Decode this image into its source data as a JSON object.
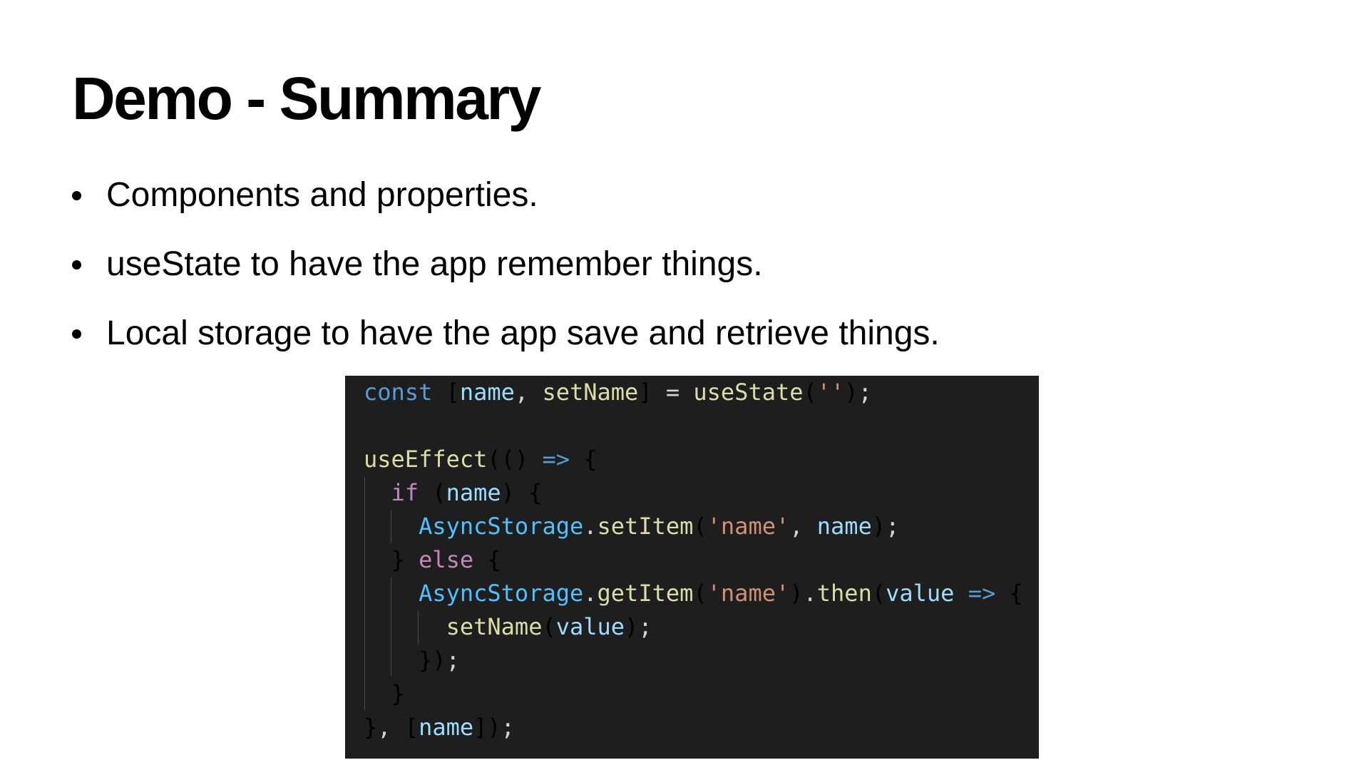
{
  "slide": {
    "title": "Demo - Summary",
    "bullets": [
      "Components and properties.",
      "useState to have the app remember things.",
      "Local storage to have the app save and retrieve things."
    ]
  },
  "code": {
    "language": "javascript",
    "background": "#1e1e1e",
    "lines": [
      "const [name, setName] = useState('');",
      "",
      "useEffect(() => {",
      "  if (name) {",
      "    AsyncStorage.setItem('name', name);",
      "  } else {",
      "    AsyncStorage.getItem('name').then(value => {",
      "      setName(value);",
      "    });",
      "  }",
      "}, [name]);"
    ]
  }
}
